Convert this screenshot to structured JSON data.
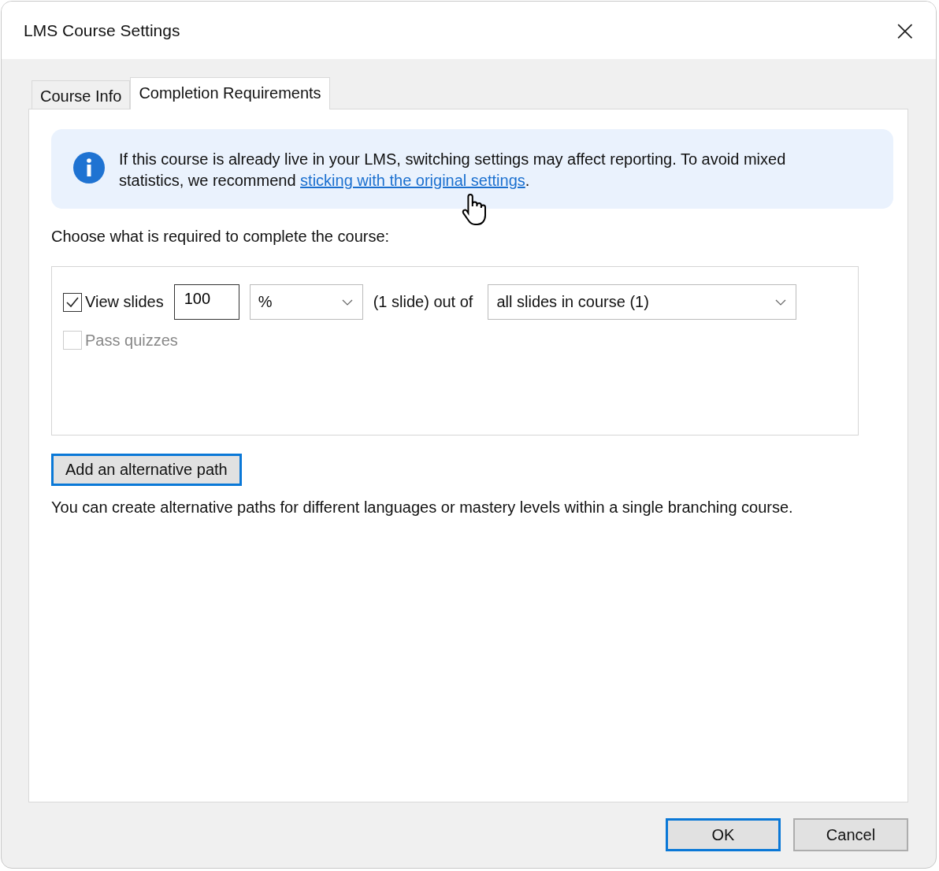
{
  "window": {
    "title": "LMS Course Settings",
    "close": "×"
  },
  "tabs": [
    {
      "label": "Course Info",
      "selected": false
    },
    {
      "label": "Completion Requirements",
      "selected": true
    }
  ],
  "info": {
    "text": "If this course is already live in your LMS, switching settings may affect reporting. To avoid mixed statistics, we recommend ",
    "link": "sticking with the original settings",
    "text_after": "."
  },
  "prompt": "Choose what is required to complete the course:",
  "requirements": [
    {
      "kind": "slides",
      "label": "View slides",
      "checked": true,
      "disabled": false,
      "amount": "100",
      "unit": "%",
      "between": "(1 slide) out of",
      "scope": "all slides in course (1)"
    },
    {
      "kind": "simple",
      "label": "Pass quizzes",
      "checked": false,
      "disabled": true
    }
  ],
  "alt_button": {
    "label": "Add an alternative path",
    "focused": true
  },
  "alt_note": "You can create alternative paths for different languages or mastery levels within a single branching course.",
  "buttons": [
    {
      "label": "OK",
      "default": true
    },
    {
      "label": "Cancel",
      "default": false
    }
  ]
}
